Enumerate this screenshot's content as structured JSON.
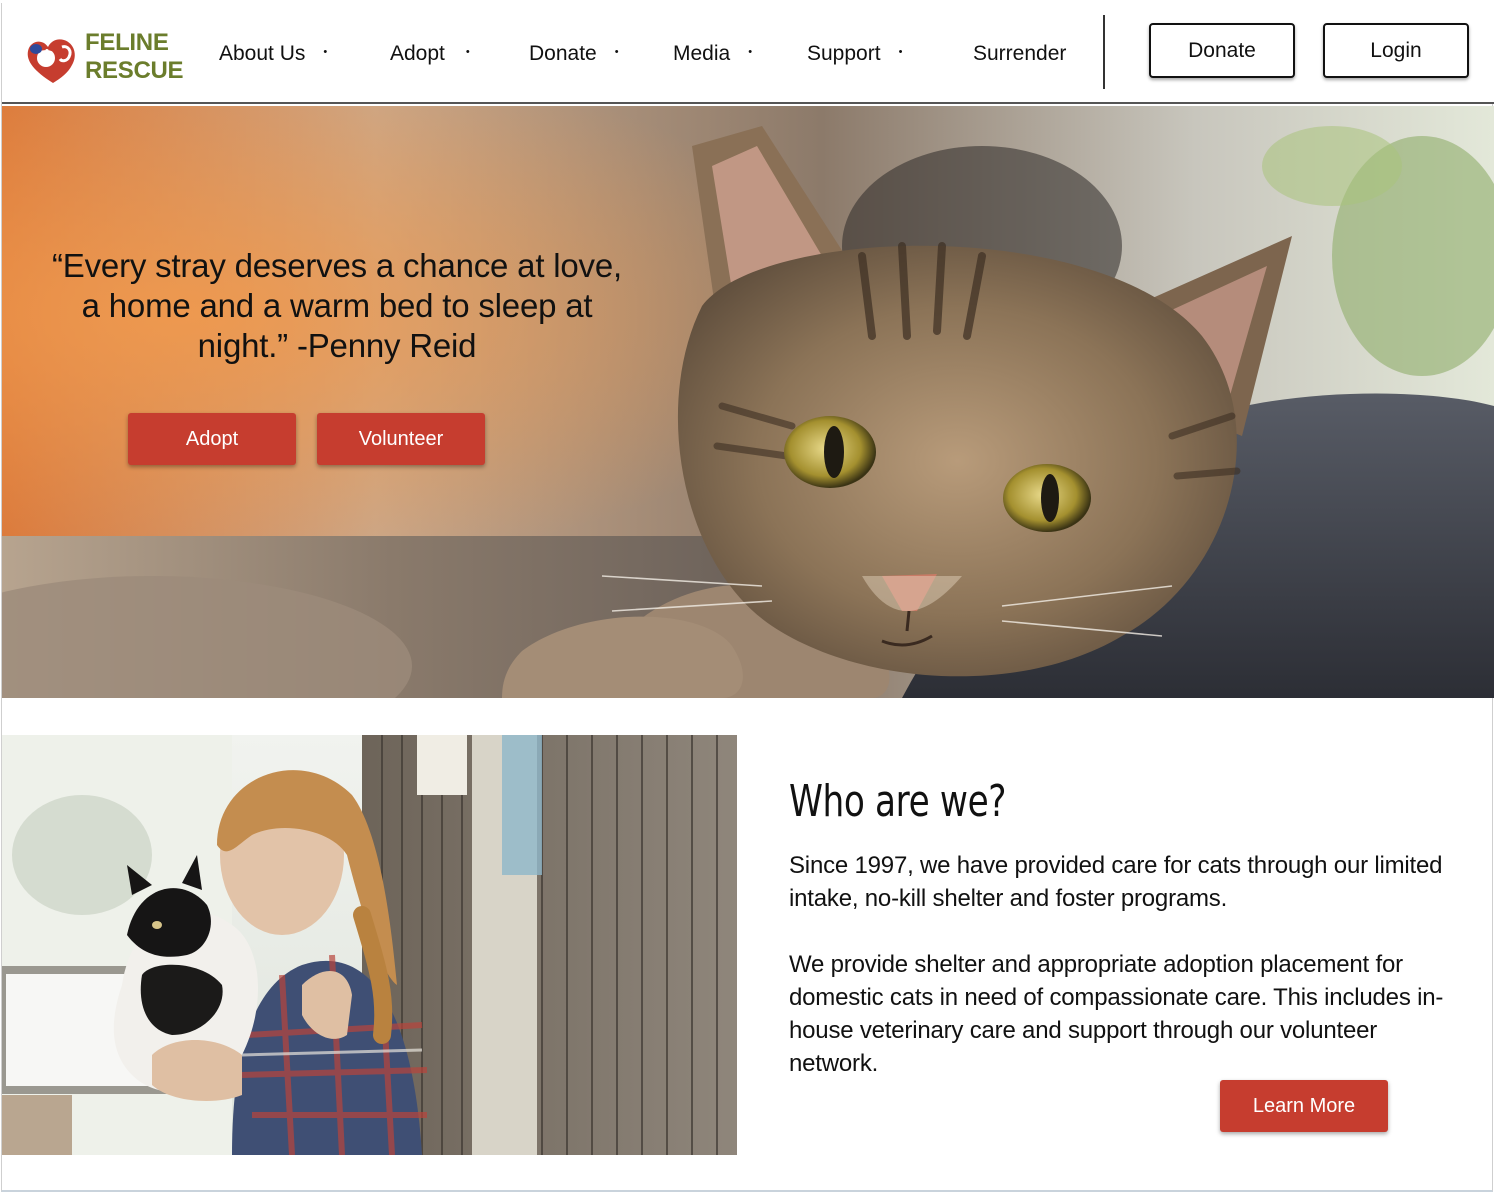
{
  "brand": {
    "name_line1": "FELINE",
    "name_line2": "RESCUE",
    "logo_icon": "cat-heart-logo-icon",
    "color_primary": "#c63d2f",
    "color_text_green": "#6b7d2c"
  },
  "nav": {
    "items": [
      {
        "label": "About Us",
        "has_dropdown": true
      },
      {
        "label": "Adopt",
        "has_dropdown": true
      },
      {
        "label": "Donate",
        "has_dropdown": true
      },
      {
        "label": "Media",
        "has_dropdown": true
      },
      {
        "label": "Support",
        "has_dropdown": true
      },
      {
        "label": "Surrender",
        "has_dropdown": false
      }
    ],
    "caret": "•",
    "donate_button": "Donate",
    "login_button": "Login"
  },
  "hero": {
    "quote": "“Every stray deserves a chance at love, a home and a warm bed to sleep at night.” -Penny Reid",
    "adopt_button": "Adopt",
    "volunteer_button": "Volunteer"
  },
  "about": {
    "title": "Who are we?",
    "paragraph1": "Since 1997, we have provided care for cats through our limited intake, no-kill shelter and foster programs.",
    "paragraph2": "We provide shelter and appropriate adoption placement for domestic cats in need of compassionate care.  This includes in-house veterinary care and support through our volunteer network.",
    "learn_more_button": "Learn More"
  }
}
